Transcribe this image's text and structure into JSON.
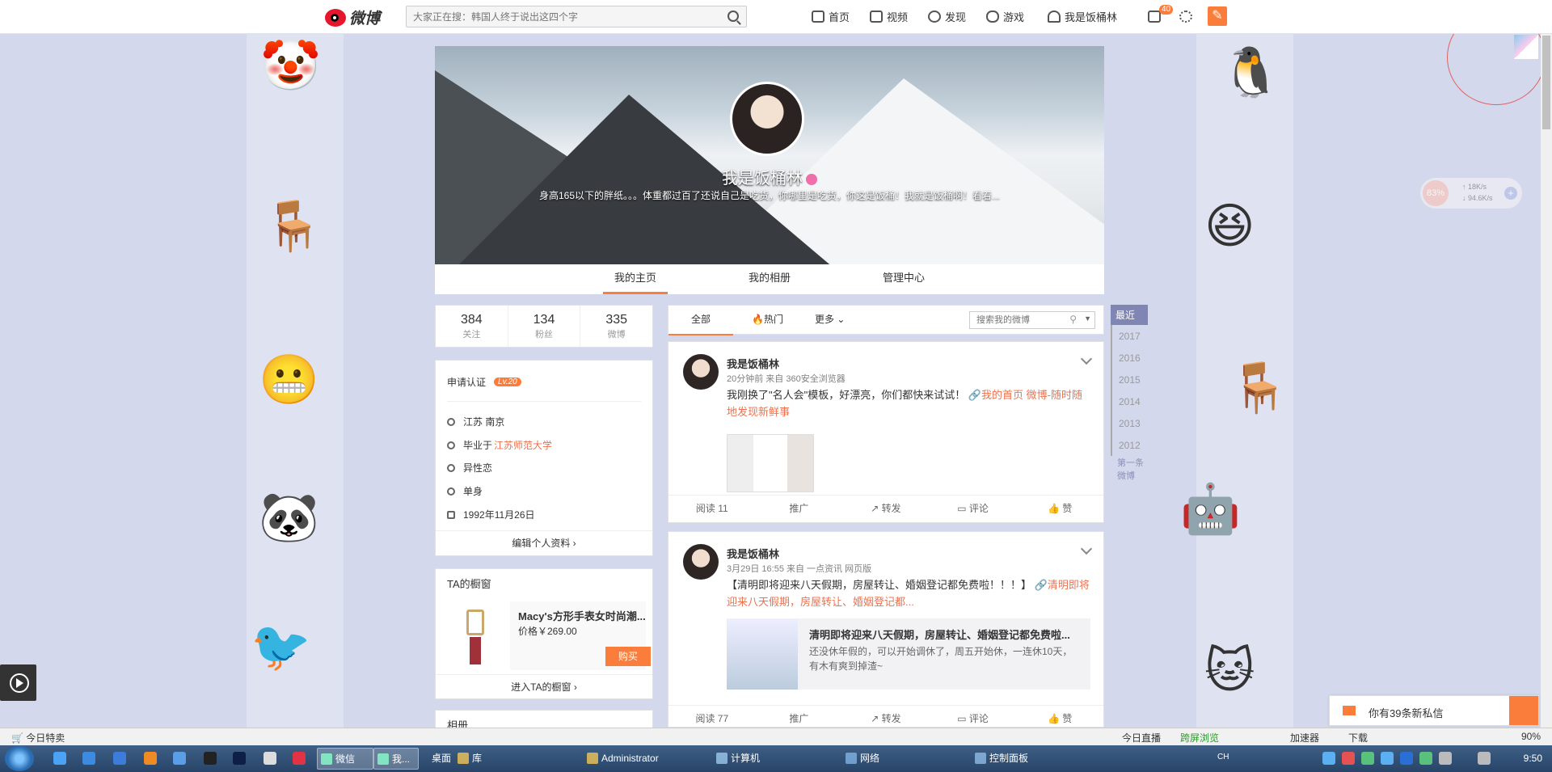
{
  "topbar": {
    "logo_text": "微博",
    "search_placeholder": "大家正在搜：韩国人终于说出这四个字",
    "nav": [
      "首页",
      "视频",
      "发现",
      "游戏",
      "我是饭桶林"
    ],
    "msg_badge": "40"
  },
  "profile": {
    "name": "我是饭桶林",
    "intro": "身高165以下的胖纸。。。体重都过百了还说自己是吃货，你哪里是吃货，你这是饭桶！我就是饭桶啊！看着...",
    "tabs": [
      "我的主页",
      "我的相册",
      "管理中心"
    ]
  },
  "stats": [
    {
      "num": "384",
      "label": "关注"
    },
    {
      "num": "134",
      "label": "粉丝"
    },
    {
      "num": "335",
      "label": "微博"
    }
  ],
  "info": {
    "apply_label": "申请认证",
    "level": "Lv.20",
    "location": "江苏 南京",
    "school_prefix": "毕业于",
    "school": "江苏师范大学",
    "orientation": "异性恋",
    "relationship": "单身",
    "birthday": "1992年11月26日",
    "edit": "编辑个人资料 ›"
  },
  "shop": {
    "title": "TA的橱窗",
    "product_name": "Macy's方形手表女时尚潮...",
    "price": "价格￥269.00",
    "buy": "购买",
    "enter": "进入TA的橱窗 ›"
  },
  "albums": {
    "title": "相册"
  },
  "feedbar": {
    "tabs": [
      "全部",
      "热门",
      "更多"
    ],
    "search_placeholder": "搜索我的微博"
  },
  "posts": [
    {
      "name": "我是饭桶林",
      "time": "20分钟前 来自 360安全浏览器",
      "text": "我刚换了\"名人会\"模板，好漂亮，你们都快来试试！",
      "link": "我的首页 微博-随时随地发现新鲜事",
      "reads": "阅读 11"
    },
    {
      "name": "我是饭桶林",
      "time": "3月29日 16:55 来自 一点资讯 网页版",
      "text": "【清明即将迎来八天假期，房屋转让、婚姻登记都免费啦！！！】",
      "link": "清明即将迎来八天假期，房屋转让、婚姻登记都...",
      "card_title": "清明即将迎来八天假期，房屋转让、婚姻登记都免费啦...",
      "card_desc": "还没休年假的，可以开始调休了，周五开始休，一连休10天，有木有爽到掉渣~",
      "reads": "阅读 77"
    }
  ],
  "post_actions": [
    "推广",
    "转发",
    "评论",
    "赞"
  ],
  "years": {
    "recent": "最近",
    "list": [
      "2017",
      "2016",
      "2015",
      "2014",
      "2013",
      "2012"
    ],
    "first": "第一条微博"
  },
  "widget": {
    "pct": "83%",
    "up": "18K/s",
    "down": "94.6K/s"
  },
  "private_msg": "你有39条新私信",
  "statusbar": {
    "left": "今日特卖",
    "items": [
      "今日直播",
      "跨屏浏览",
      "加速器",
      "下载"
    ],
    "zoom": "90%"
  },
  "taskbar": {
    "buttons": [
      "微信",
      "我...",
      "桌面",
      "库",
      "Administrator",
      "计算机",
      "网络",
      "控制面板"
    ],
    "clock": "9:50",
    "lang": "CH"
  }
}
